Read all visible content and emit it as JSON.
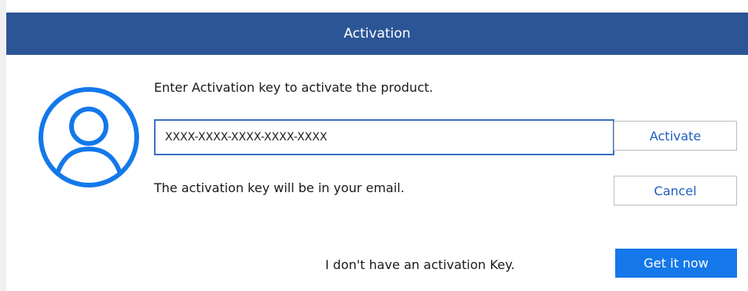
{
  "dialog": {
    "title": "Activation",
    "prompt": "Enter Activation key to activate the product.",
    "key_field": {
      "value": "XXXX-XXXX-XXXX-XXXX-XXXX",
      "placeholder": ""
    },
    "email_note": "The activation key will be in your email.",
    "no_key_text": "I don't have an activation Key.",
    "activate_label": "Activate",
    "cancel_label": "Cancel",
    "get_it_now_label": "Get it now"
  },
  "icons": {
    "avatar": "user-circle-icon"
  },
  "colors": {
    "titlebar": "#2c5596",
    "accent": "#1478ea",
    "link_text": "#1f5fbf",
    "input_border": "#3b6fc4"
  }
}
